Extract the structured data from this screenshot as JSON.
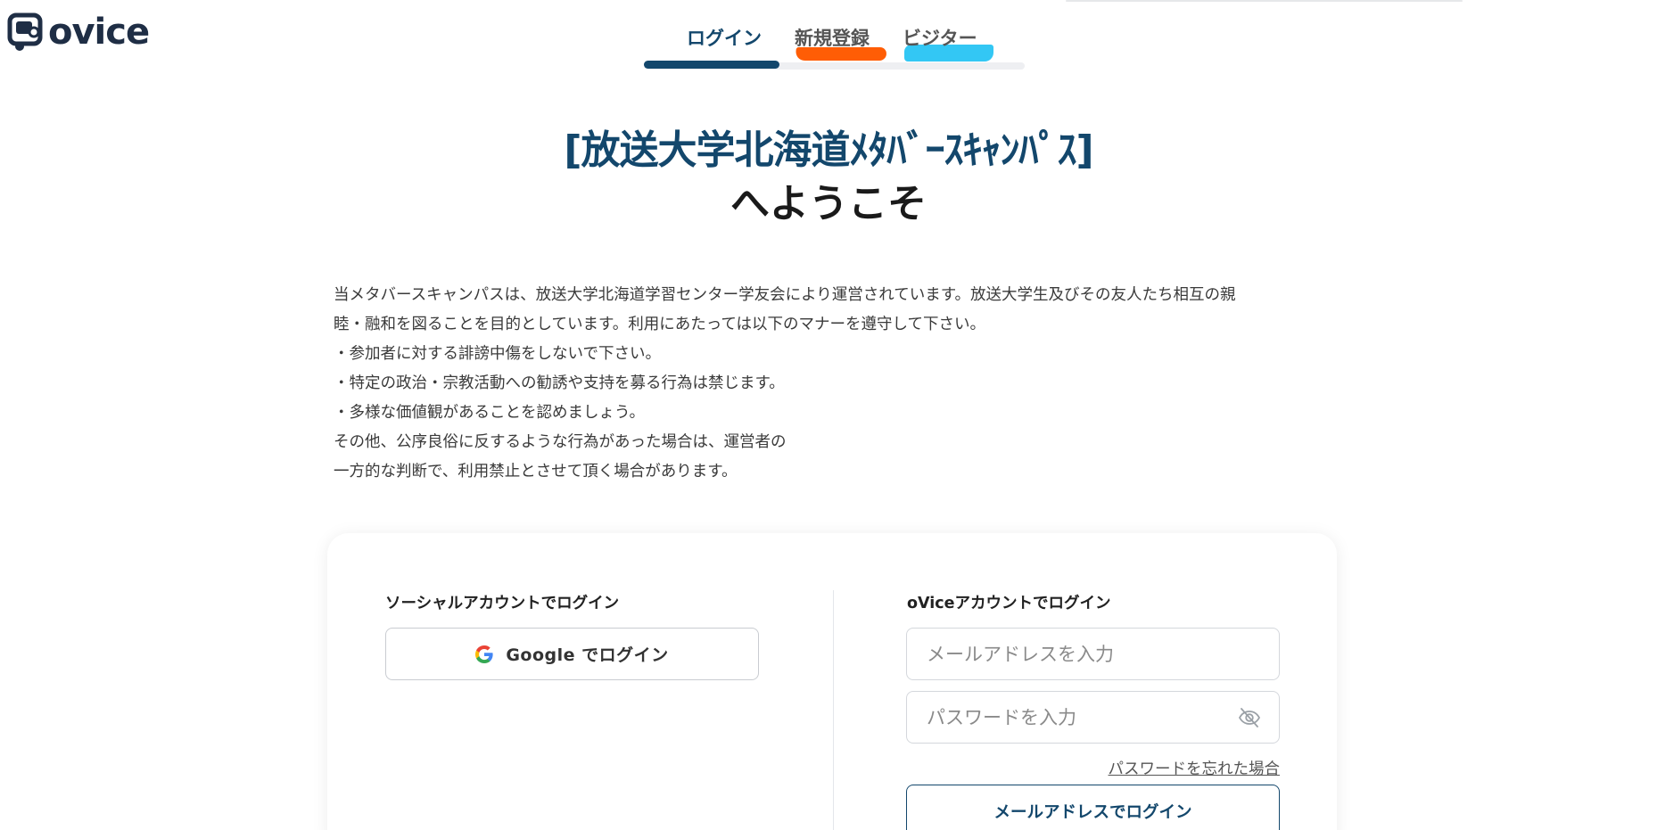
{
  "brand": {
    "name": "ovice"
  },
  "tabs": [
    {
      "label": "ログイン",
      "active": true
    },
    {
      "label": "新規登録",
      "active": false
    },
    {
      "label": "ビジター",
      "active": false
    }
  ],
  "welcome": {
    "title": "[放送大学北海道ﾒﾀﾊﾞｰｽｷｬﾝﾊﾟｽ]",
    "subtitle": "へようこそ"
  },
  "description": {
    "lines": [
      "当メタバースキャンパスは、放送大学北海道学習センター学友会により運営されています。放送大学生及びその友人たち相互の親",
      "睦・融和を図ることを目的としています。利用にあたっては以下のマナーを遵守して下さい。",
      "・参加者に対する誹謗中傷をしないで下さい。",
      "・特定の政治・宗教活動への勧誘や支持を募る行為は禁じます。",
      "・多様な価値観があることを認めましょう。",
      "その他、公序良俗に反するような行為があった場合は、運営者の",
      "一方的な判断で、利用禁止とさせて頂く場合があります。"
    ]
  },
  "social": {
    "title": "ソーシャルアカウントでログイン",
    "google_label": "Google でログイン"
  },
  "ovice_login": {
    "title": "oViceアカウントでログイン",
    "email_placeholder": "メールアドレスを入力",
    "password_placeholder": "パスワードを入力",
    "forgot_label": "パスワードを忘れた場合",
    "submit_label": "メールアドレスでログイン"
  },
  "colors": {
    "primary": "#13476c",
    "highlight_orange": "#ff5a00",
    "highlight_cyan": "#2fc6f4"
  }
}
